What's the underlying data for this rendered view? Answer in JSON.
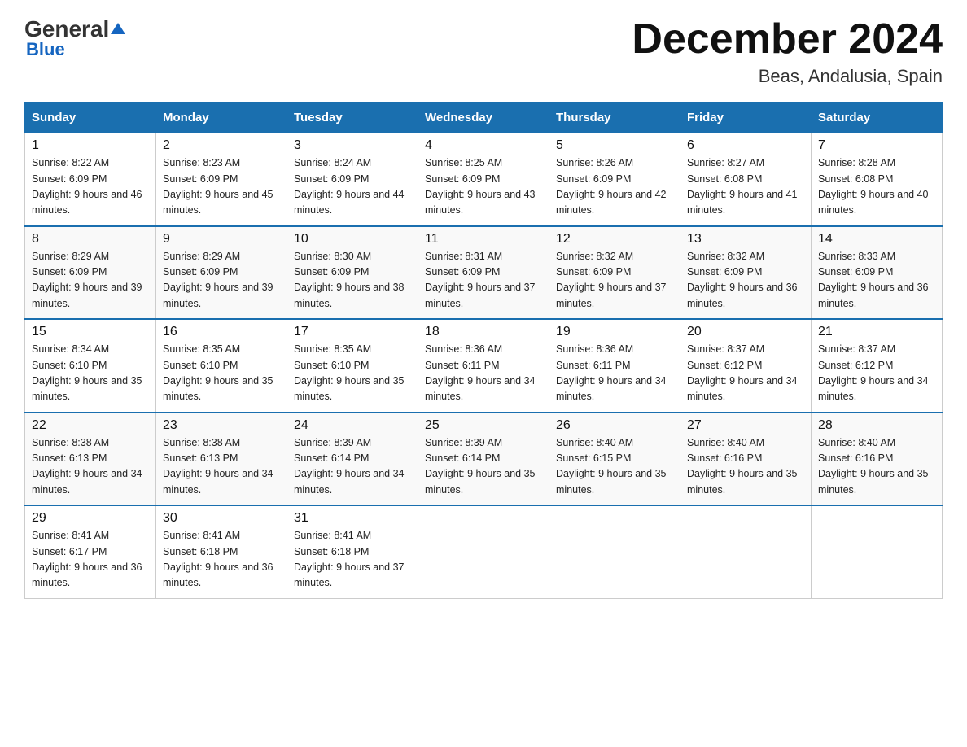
{
  "logo": {
    "general": "General",
    "blue": "Blue",
    "tagline": "Blue"
  },
  "header": {
    "month": "December 2024",
    "location": "Beas, Andalusia, Spain"
  },
  "weekdays": [
    "Sunday",
    "Monday",
    "Tuesday",
    "Wednesday",
    "Thursday",
    "Friday",
    "Saturday"
  ],
  "weeks": [
    [
      {
        "day": "1",
        "sunrise": "8:22 AM",
        "sunset": "6:09 PM",
        "daylight": "9 hours and 46 minutes."
      },
      {
        "day": "2",
        "sunrise": "8:23 AM",
        "sunset": "6:09 PM",
        "daylight": "9 hours and 45 minutes."
      },
      {
        "day": "3",
        "sunrise": "8:24 AM",
        "sunset": "6:09 PM",
        "daylight": "9 hours and 44 minutes."
      },
      {
        "day": "4",
        "sunrise": "8:25 AM",
        "sunset": "6:09 PM",
        "daylight": "9 hours and 43 minutes."
      },
      {
        "day": "5",
        "sunrise": "8:26 AM",
        "sunset": "6:09 PM",
        "daylight": "9 hours and 42 minutes."
      },
      {
        "day": "6",
        "sunrise": "8:27 AM",
        "sunset": "6:08 PM",
        "daylight": "9 hours and 41 minutes."
      },
      {
        "day": "7",
        "sunrise": "8:28 AM",
        "sunset": "6:08 PM",
        "daylight": "9 hours and 40 minutes."
      }
    ],
    [
      {
        "day": "8",
        "sunrise": "8:29 AM",
        "sunset": "6:09 PM",
        "daylight": "9 hours and 39 minutes."
      },
      {
        "day": "9",
        "sunrise": "8:29 AM",
        "sunset": "6:09 PM",
        "daylight": "9 hours and 39 minutes."
      },
      {
        "day": "10",
        "sunrise": "8:30 AM",
        "sunset": "6:09 PM",
        "daylight": "9 hours and 38 minutes."
      },
      {
        "day": "11",
        "sunrise": "8:31 AM",
        "sunset": "6:09 PM",
        "daylight": "9 hours and 37 minutes."
      },
      {
        "day": "12",
        "sunrise": "8:32 AM",
        "sunset": "6:09 PM",
        "daylight": "9 hours and 37 minutes."
      },
      {
        "day": "13",
        "sunrise": "8:32 AM",
        "sunset": "6:09 PM",
        "daylight": "9 hours and 36 minutes."
      },
      {
        "day": "14",
        "sunrise": "8:33 AM",
        "sunset": "6:09 PM",
        "daylight": "9 hours and 36 minutes."
      }
    ],
    [
      {
        "day": "15",
        "sunrise": "8:34 AM",
        "sunset": "6:10 PM",
        "daylight": "9 hours and 35 minutes."
      },
      {
        "day": "16",
        "sunrise": "8:35 AM",
        "sunset": "6:10 PM",
        "daylight": "9 hours and 35 minutes."
      },
      {
        "day": "17",
        "sunrise": "8:35 AM",
        "sunset": "6:10 PM",
        "daylight": "9 hours and 35 minutes."
      },
      {
        "day": "18",
        "sunrise": "8:36 AM",
        "sunset": "6:11 PM",
        "daylight": "9 hours and 34 minutes."
      },
      {
        "day": "19",
        "sunrise": "8:36 AM",
        "sunset": "6:11 PM",
        "daylight": "9 hours and 34 minutes."
      },
      {
        "day": "20",
        "sunrise": "8:37 AM",
        "sunset": "6:12 PM",
        "daylight": "9 hours and 34 minutes."
      },
      {
        "day": "21",
        "sunrise": "8:37 AM",
        "sunset": "6:12 PM",
        "daylight": "9 hours and 34 minutes."
      }
    ],
    [
      {
        "day": "22",
        "sunrise": "8:38 AM",
        "sunset": "6:13 PM",
        "daylight": "9 hours and 34 minutes."
      },
      {
        "day": "23",
        "sunrise": "8:38 AM",
        "sunset": "6:13 PM",
        "daylight": "9 hours and 34 minutes."
      },
      {
        "day": "24",
        "sunrise": "8:39 AM",
        "sunset": "6:14 PM",
        "daylight": "9 hours and 34 minutes."
      },
      {
        "day": "25",
        "sunrise": "8:39 AM",
        "sunset": "6:14 PM",
        "daylight": "9 hours and 35 minutes."
      },
      {
        "day": "26",
        "sunrise": "8:40 AM",
        "sunset": "6:15 PM",
        "daylight": "9 hours and 35 minutes."
      },
      {
        "day": "27",
        "sunrise": "8:40 AM",
        "sunset": "6:16 PM",
        "daylight": "9 hours and 35 minutes."
      },
      {
        "day": "28",
        "sunrise": "8:40 AM",
        "sunset": "6:16 PM",
        "daylight": "9 hours and 35 minutes."
      }
    ],
    [
      {
        "day": "29",
        "sunrise": "8:41 AM",
        "sunset": "6:17 PM",
        "daylight": "9 hours and 36 minutes."
      },
      {
        "day": "30",
        "sunrise": "8:41 AM",
        "sunset": "6:18 PM",
        "daylight": "9 hours and 36 minutes."
      },
      {
        "day": "31",
        "sunrise": "8:41 AM",
        "sunset": "6:18 PM",
        "daylight": "9 hours and 37 minutes."
      },
      null,
      null,
      null,
      null
    ]
  ]
}
